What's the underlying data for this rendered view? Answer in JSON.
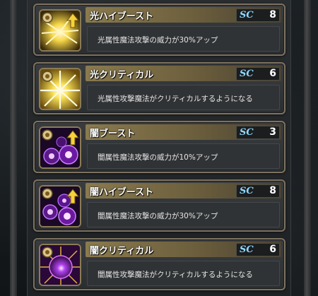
{
  "skills": [
    {
      "name": "光ハイブースト",
      "sc": "8",
      "description": "光属性魔法攻撃の威力が30%アップ",
      "icon": "light-high-boost-icon",
      "has_up_arrow": true
    },
    {
      "name": "光クリティカル",
      "sc": "6",
      "description": "光属性攻撃魔法がクリティカルするようになる",
      "icon": "light-critical-icon",
      "has_up_arrow": false
    },
    {
      "name": "闇ブースト",
      "sc": "3",
      "description": "闇属性魔法攻撃の威力が10%アップ",
      "icon": "dark-boost-icon",
      "has_up_arrow": true
    },
    {
      "name": "闇ハイブースト",
      "sc": "8",
      "description": "闇属性魔法攻撃の威力が30%アップ",
      "icon": "dark-high-boost-icon",
      "has_up_arrow": true
    },
    {
      "name": "闇クリティカル",
      "sc": "6",
      "description": "闇属性攻撃魔法がクリティカルするようになる",
      "icon": "dark-critical-icon",
      "has_up_arrow": false
    }
  ],
  "sc_label": "SC",
  "colors": {
    "card_border": "#7d7360",
    "title_bar": "#8a7a4e",
    "sc_label": "#8fd8ff",
    "light_element": "#f5d64a",
    "dark_element": "#b04cf0"
  }
}
